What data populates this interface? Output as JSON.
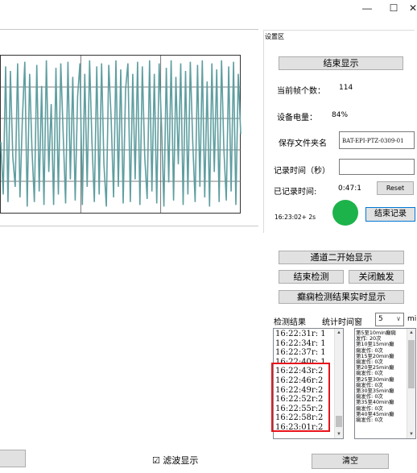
{
  "window": {
    "minimize_glyph": "—",
    "maximize_glyph": "☐",
    "close_glyph": "✕"
  },
  "settings": {
    "group_label": "设置区",
    "end_display_label": "结束显示",
    "frame_count_label": "当前帧个数：",
    "frame_count_value": "114",
    "battery_label": "设备电量：",
    "battery_value": "84%",
    "folder_label": "保存文件夹名",
    "folder_value": "BAT-EPI-PTZ-0309-01",
    "record_time_label": "记录时间（秒）",
    "record_time_value": "",
    "recorded_time_label": "已记录时间:",
    "recorded_time_value": "0:47:1",
    "reset_label": "Reset",
    "timestamp": "16:23:02+ 2s",
    "status_color": "#1db34b",
    "end_record_label": "结束记录",
    "channel2_label": "通道二开始显示",
    "end_detect_label": "结束检测",
    "close_trigger_label": "关闭触发",
    "realtime_label": "癫痫检测结果实时显示"
  },
  "results": {
    "label": "检测结果",
    "stats_label": "统计时间窗",
    "window_value": "5",
    "window_unit": "min",
    "log": [
      "16:22:31r: 1",
      "16:22:34r: 1",
      "16:22:37r: 1",
      "16:22:40r: 1",
      "16:22:43r:2",
      "16:22:46r:2",
      "16:22:49r:2",
      "16:22:52r:2",
      "16:22:55r:2",
      "16:22:58r:2",
      "16:23:01r:2"
    ],
    "stats": [
      "第5至10min癫痫",
      "发作: 20次",
      "第10至15min癫",
      "痫发作: 0次",
      "第15至20min癫",
      "痫发作: 0次",
      "第20至25min癫",
      "痫发作: 0次",
      "第25至30min癫",
      "痫发作: 0次",
      "第30至35min癫",
      "痫发作: 0次",
      "第35至40min癫",
      "痫发作: 0次",
      "第40至45min癫",
      "痫发作: 0次"
    ],
    "clear_label": "清空"
  },
  "bottom": {
    "filter_checkbox_glyph": "☑",
    "filter_label": "滤波显示"
  },
  "colors": {
    "waveform": "#5f9ea0",
    "highlight": "#e8131b"
  },
  "chart_data": {
    "type": "line",
    "series": [
      {
        "values": [
          0.45,
          0.1,
          0.95,
          0.05,
          0.92,
          0.35,
          0.15,
          0.97,
          0.08,
          0.6,
          0.98,
          0.02,
          0.9,
          0.4,
          0.05,
          0.96,
          0.12,
          0.82,
          0.03,
          0.99,
          0.25,
          0.7,
          0.03,
          0.94,
          0.1,
          0.97,
          0.5,
          0.04,
          0.98,
          0.2,
          0.88,
          0.06,
          0.75,
          0.97,
          0.03,
          0.9,
          0.15,
          0.99,
          0.45,
          0.05,
          0.95,
          0.1,
          0.97,
          0.3,
          0.02,
          0.96,
          0.6,
          0.08,
          0.99,
          0.15,
          0.93,
          0.04,
          0.8,
          0.97,
          0.05,
          0.9,
          0.2,
          0.98,
          0.03,
          0.95,
          0.35,
          0.07,
          0.99,
          0.12,
          0.9,
          0.04,
          0.97,
          0.55,
          0.02,
          0.94,
          0.18,
          0.99,
          0.06,
          0.88,
          0.3,
          0.97,
          0.03,
          0.92,
          0.1,
          0.98,
          0.45,
          0.05,
          0.96,
          0.15,
          0.99,
          0.08,
          0.85,
          0.02,
          0.97,
          0.25,
          0.93,
          0.05,
          0.99,
          0.4,
          0.06,
          0.95,
          0.12,
          0.98,
          0.03,
          0.9,
          0.5
        ]
      }
    ],
    "grid": true
  }
}
